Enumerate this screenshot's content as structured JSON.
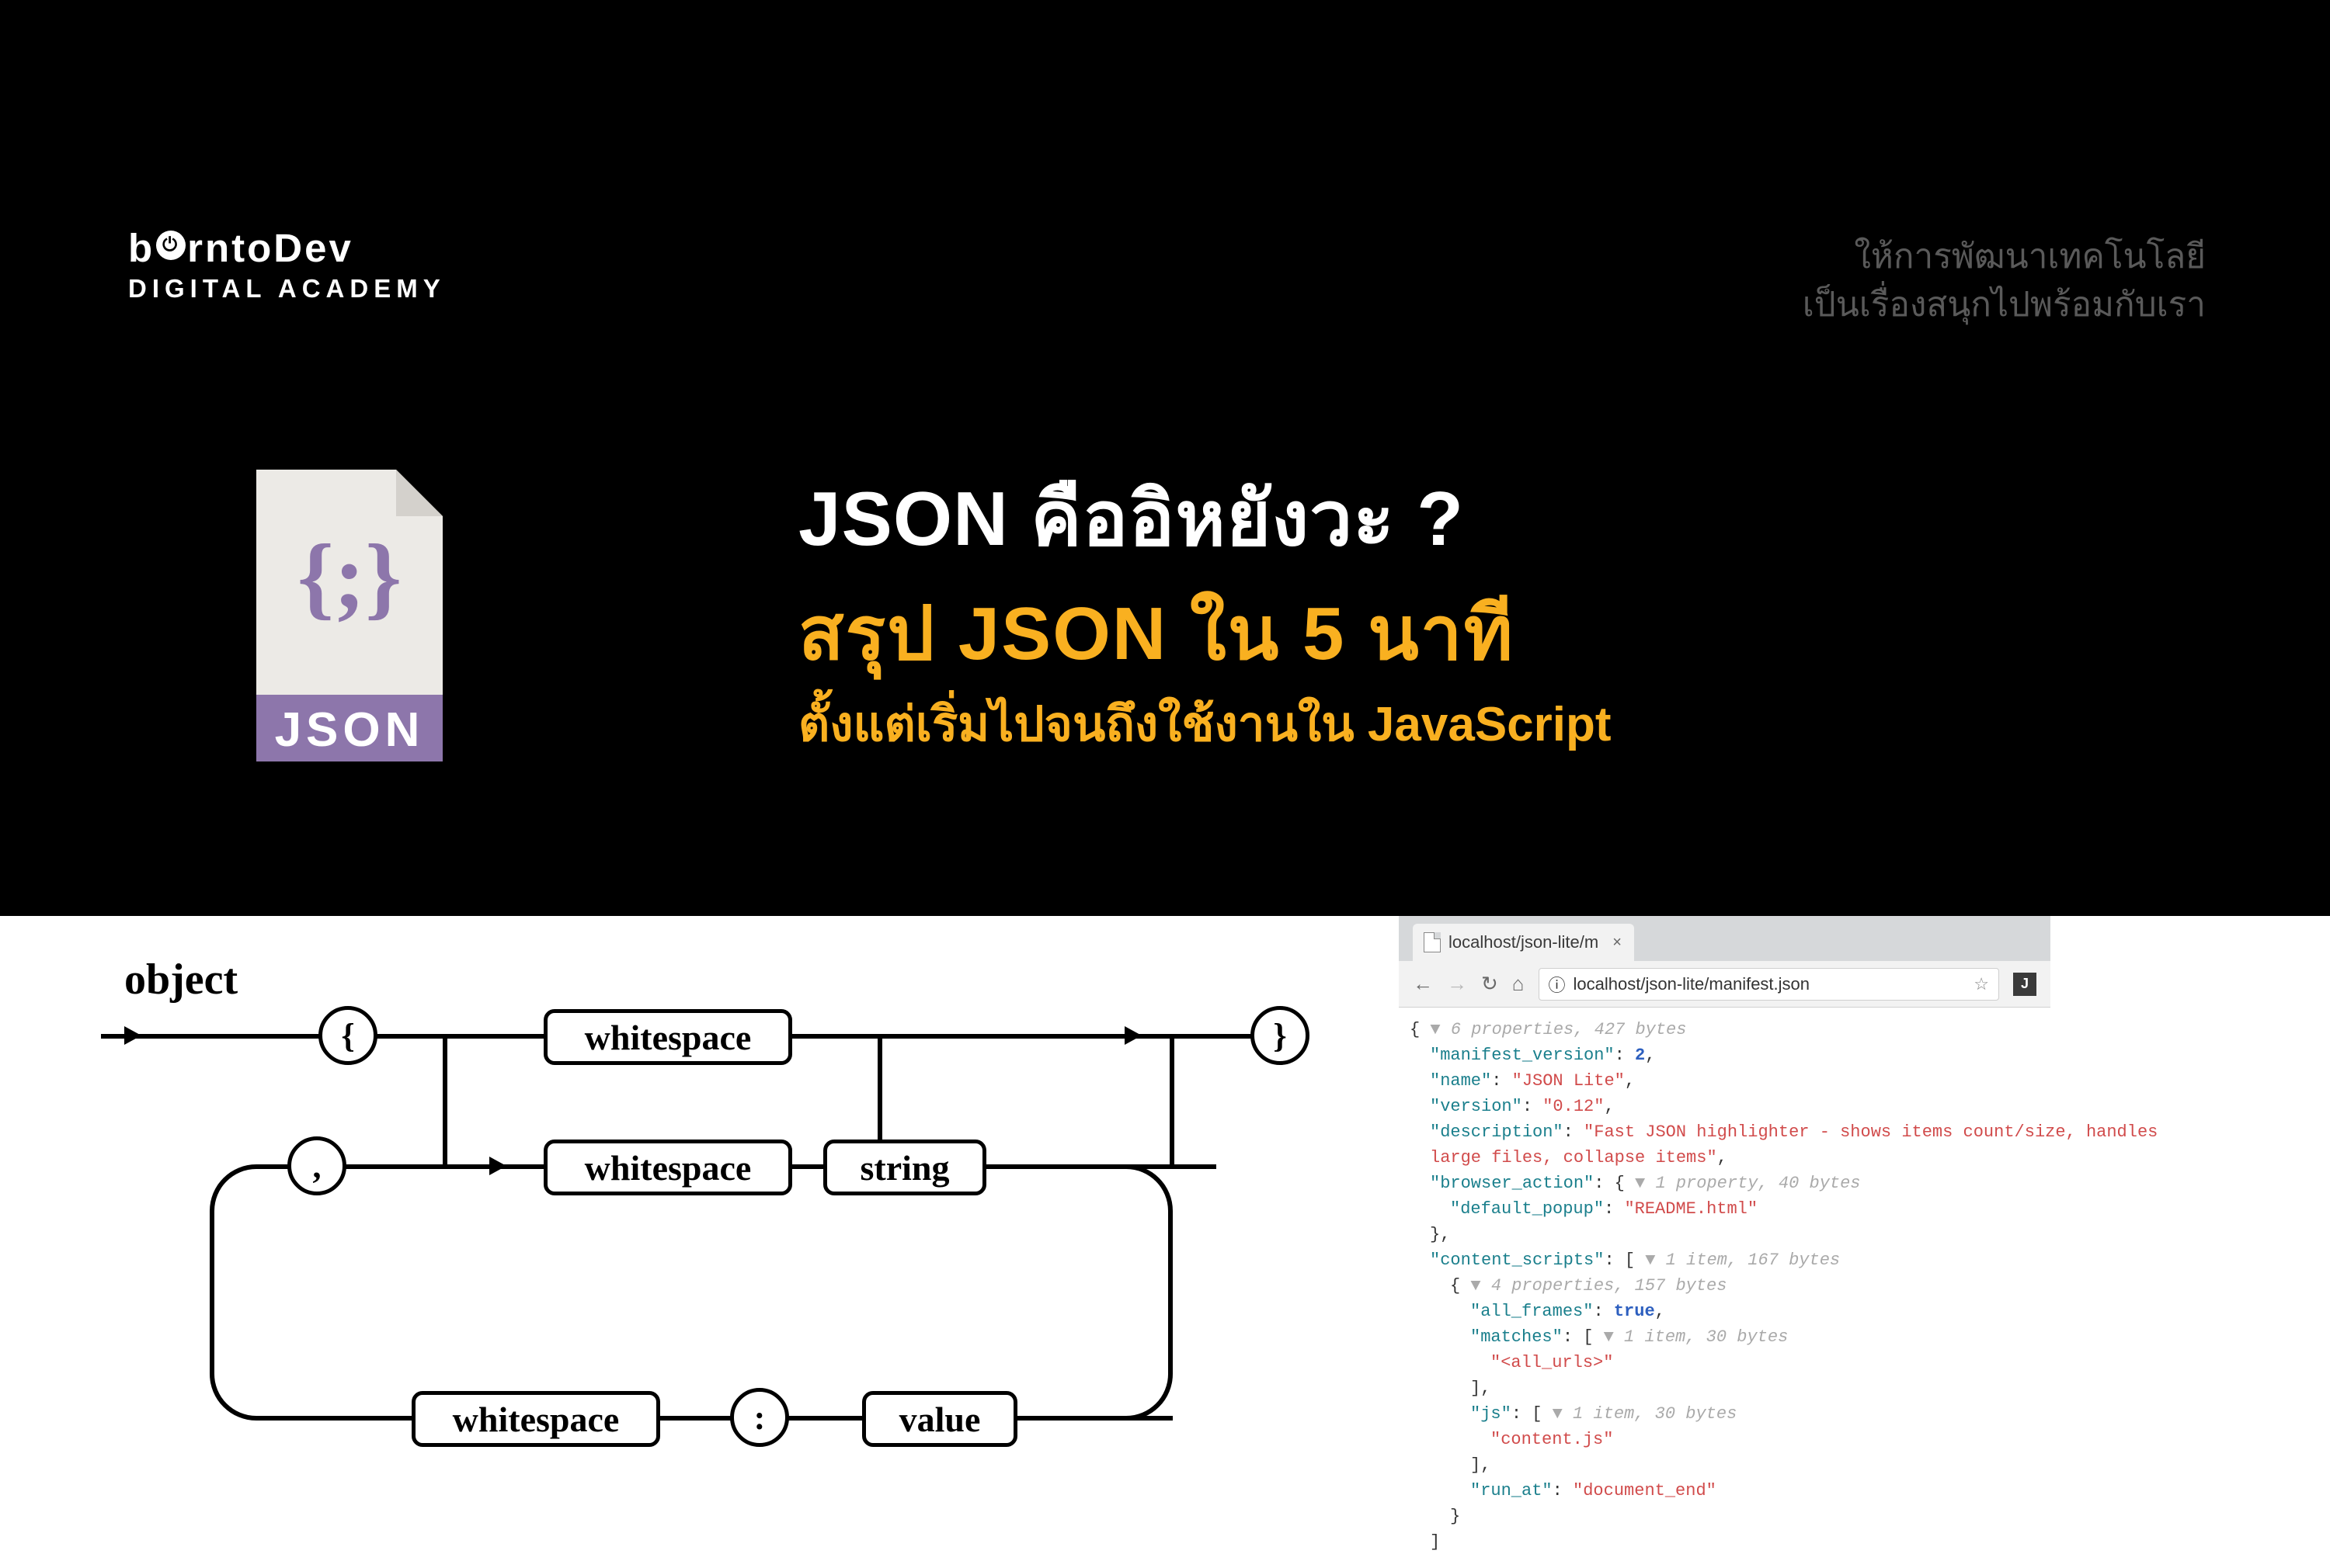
{
  "brand": {
    "name_part1": "b",
    "name_part2": "rntoDev",
    "academy": "DIGITAL ACADEMY"
  },
  "tagline": {
    "line1": "ให้การพัฒนาเทคโนโลยี",
    "line2": "เป็นเรื่องสนุกไปพร้อมกับเรา"
  },
  "json_icon": {
    "braces": "{;}",
    "label": "JSON"
  },
  "title": {
    "line1": "JSON คืออิหยังวะ ?",
    "line2": "สรุป JSON ใน 5 นาที",
    "line3": "ตั้งแต่เริ่มไปจนถึงใช้งานใน JavaScript"
  },
  "railroad": {
    "heading": "object",
    "open_brace": "{",
    "close_brace": "}",
    "comma": ",",
    "colon": ":",
    "whitespace": "whitespace",
    "string": "string",
    "value": "value"
  },
  "browser": {
    "tab_title": "localhost/json-lite/m",
    "tab_close": "×",
    "url_info_icon": "ⓘ",
    "url": "localhost/json-lite/manifest.json",
    "star": "☆",
    "ext_badge": "J",
    "nav": {
      "back": "←",
      "forward": "→",
      "reload": "↻",
      "home": "⌂"
    }
  },
  "jsonview": {
    "root_meta": "6 properties, 427 bytes",
    "kv": {
      "manifest_version_k": "\"manifest_version\"",
      "manifest_version_v": "2",
      "name_k": "\"name\"",
      "name_v": "\"JSON Lite\"",
      "version_k": "\"version\"",
      "version_v": "\"0.12\"",
      "description_k": "\"description\"",
      "description_v": "\"Fast JSON highlighter - shows items count/size, handles",
      "description_v2": "large files, collapse items\"",
      "browser_action_k": "\"browser_action\"",
      "browser_action_meta": "1 property, 40 bytes",
      "default_popup_k": "\"default_popup\"",
      "default_popup_v": "\"README.html\"",
      "content_scripts_k": "\"content_scripts\"",
      "content_scripts_meta": "1 item, 167 bytes",
      "cs_obj_meta": "4 properties, 157 bytes",
      "all_frames_k": "\"all_frames\"",
      "all_frames_v": "true",
      "matches_k": "\"matches\"",
      "matches_meta": "1 item, 30 bytes",
      "matches_v": "\"<all_urls>\"",
      "js_k": "\"js\"",
      "js_meta": "1 item, 30 bytes",
      "js_v": "\"content.js\"",
      "run_at_k": "\"run_at\"",
      "run_at_v": "\"document_end\""
    },
    "punc": {
      "lb": "{",
      "rb": "}",
      "lsq": "[",
      "rsq": "]",
      "colon": ": ",
      "comma": ",",
      "tri": "▼ "
    }
  }
}
